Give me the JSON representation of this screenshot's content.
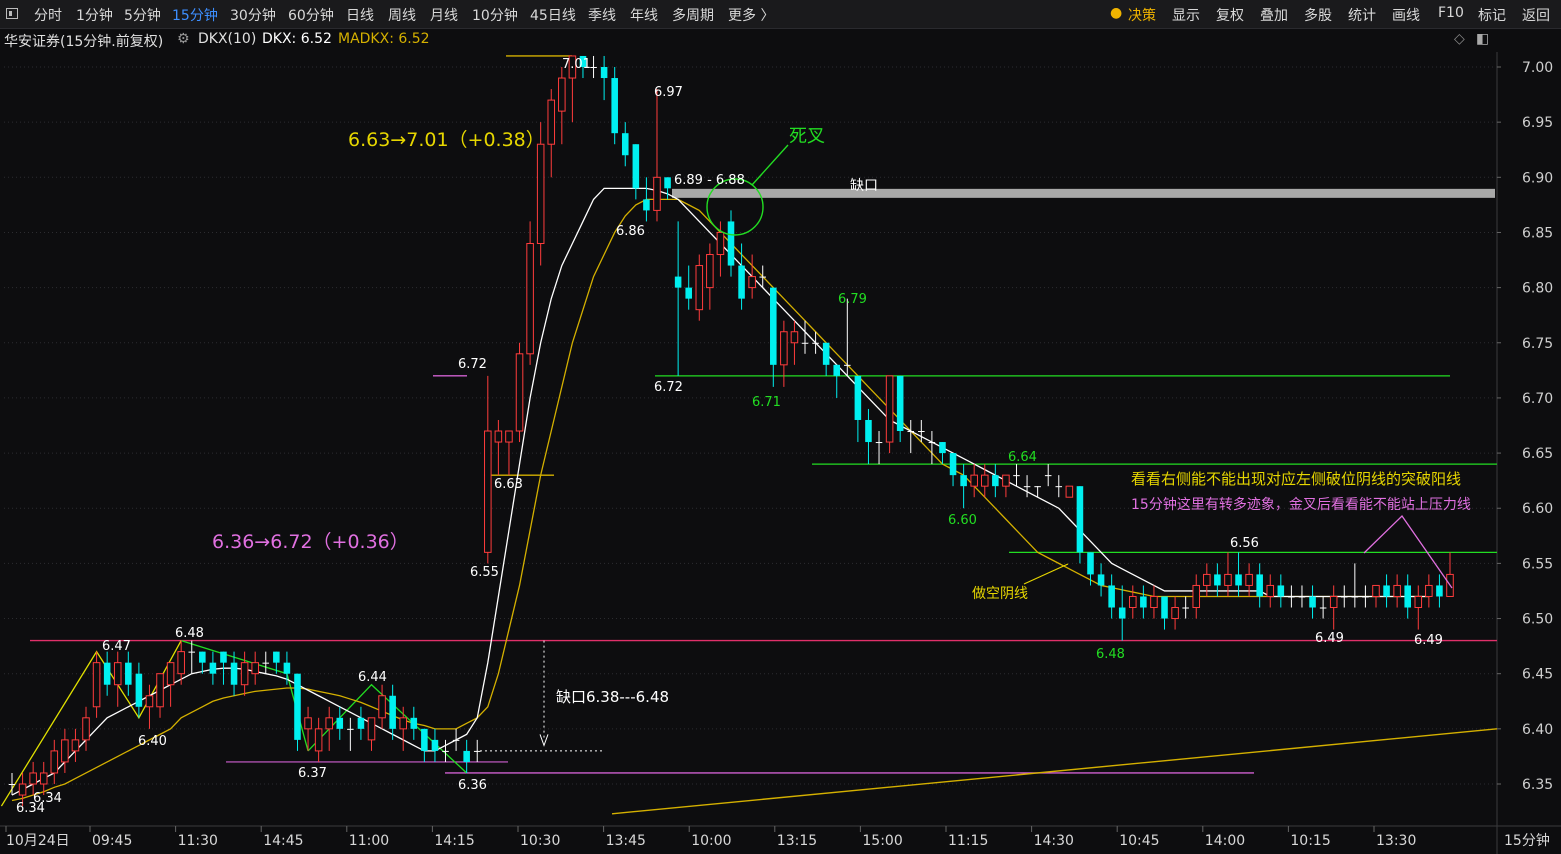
{
  "toolbar": {
    "periods": [
      "分时",
      "1分钟",
      "5分钟",
      "15分钟",
      "30分钟",
      "60分钟",
      "日线",
      "周线",
      "月线",
      "10分钟",
      "45日线",
      "季线",
      "年线",
      "多周期",
      "更多 〉"
    ],
    "active_period": "15分钟",
    "right_items": [
      "决策",
      "显示",
      "复权",
      "叠加",
      "多股",
      "统计",
      "画线",
      "F10",
      "标记",
      "返回"
    ]
  },
  "info": {
    "title": "华安证券(15分钟.前复权)",
    "indicator": "DKX(10)",
    "dkx": "DKX: 6.52",
    "madkx": "MADKX: 6.52"
  },
  "chart_data": {
    "type": "candlestick",
    "title": "华安证券(15分钟.前复权)",
    "period_label": "15分钟",
    "ylim": [
      6.31,
      7.05
    ],
    "y_ticks": [
      6.35,
      6.4,
      6.45,
      6.5,
      6.55,
      6.6,
      6.65,
      6.7,
      6.75,
      6.8,
      6.85,
      6.9,
      6.95,
      7.0
    ],
    "x_tick_labels": [
      "10月24日",
      "09:45",
      "11:30",
      "14:45",
      "11:00",
      "14:15",
      "10:30",
      "13:45",
      "10:00",
      "13:15",
      "15:00",
      "11:15",
      "14:30",
      "10:45",
      "14:00",
      "10:15",
      "13:30"
    ],
    "colors": {
      "up": "#ff3c3c",
      "down": "#00f0f0",
      "doji": "#ffffff",
      "dkx": "#ffffff",
      "madkx": "#d4b000",
      "bg": "#0d0d0f",
      "grid": "#2c2c30"
    },
    "candles": [
      {
        "o": 6.35,
        "h": 6.36,
        "l": 6.34,
        "c": 6.35
      },
      {
        "o": 6.34,
        "h": 6.36,
        "l": 6.33,
        "c": 6.35
      },
      {
        "o": 6.35,
        "h": 6.37,
        "l": 6.34,
        "c": 6.36
      },
      {
        "o": 6.35,
        "h": 6.37,
        "l": 6.34,
        "c": 6.36
      },
      {
        "o": 6.36,
        "h": 6.39,
        "l": 6.35,
        "c": 6.38
      },
      {
        "o": 6.37,
        "h": 6.4,
        "l": 6.36,
        "c": 6.39
      },
      {
        "o": 6.38,
        "h": 6.4,
        "l": 6.37,
        "c": 6.39
      },
      {
        "o": 6.39,
        "h": 6.42,
        "l": 6.38,
        "c": 6.41
      },
      {
        "o": 6.42,
        "h": 6.47,
        "l": 6.41,
        "c": 6.46
      },
      {
        "o": 6.46,
        "h": 6.47,
        "l": 6.43,
        "c": 6.44
      },
      {
        "o": 6.44,
        "h": 6.47,
        "l": 6.42,
        "c": 6.46
      },
      {
        "o": 6.46,
        "h": 6.47,
        "l": 6.43,
        "c": 6.44
      },
      {
        "o": 6.45,
        "h": 6.46,
        "l": 6.41,
        "c": 6.42
      },
      {
        "o": 6.42,
        "h": 6.44,
        "l": 6.4,
        "c": 6.43
      },
      {
        "o": 6.42,
        "h": 6.45,
        "l": 6.41,
        "c": 6.45
      },
      {
        "o": 6.44,
        "h": 6.46,
        "l": 6.42,
        "c": 6.46
      },
      {
        "o": 6.45,
        "h": 6.48,
        "l": 6.44,
        "c": 6.47
      },
      {
        "o": 6.47,
        "h": 6.48,
        "l": 6.45,
        "c": 6.47
      },
      {
        "o": 6.47,
        "h": 6.47,
        "l": 6.45,
        "c": 6.46
      },
      {
        "o": 6.46,
        "h": 6.47,
        "l": 6.44,
        "c": 6.45
      },
      {
        "o": 6.47,
        "h": 6.47,
        "l": 6.44,
        "c": 6.46
      },
      {
        "o": 6.46,
        "h": 6.47,
        "l": 6.43,
        "c": 6.44
      },
      {
        "o": 6.44,
        "h": 6.47,
        "l": 6.43,
        "c": 6.46
      },
      {
        "o": 6.45,
        "h": 6.47,
        "l": 6.44,
        "c": 6.46
      },
      {
        "o": 6.46,
        "h": 6.47,
        "l": 6.45,
        "c": 6.46
      },
      {
        "o": 6.47,
        "h": 6.47,
        "l": 6.45,
        "c": 6.46
      },
      {
        "o": 6.46,
        "h": 6.47,
        "l": 6.44,
        "c": 6.45
      },
      {
        "o": 6.45,
        "h": 6.45,
        "l": 6.38,
        "c": 6.39
      },
      {
        "o": 6.4,
        "h": 6.42,
        "l": 6.38,
        "c": 6.41
      },
      {
        "o": 6.38,
        "h": 6.41,
        "l": 6.37,
        "c": 6.4
      },
      {
        "o": 6.4,
        "h": 6.42,
        "l": 6.38,
        "c": 6.41
      },
      {
        "o": 6.41,
        "h": 6.42,
        "l": 6.39,
        "c": 6.4
      },
      {
        "o": 6.4,
        "h": 6.41,
        "l": 6.38,
        "c": 6.4
      },
      {
        "o": 6.41,
        "h": 6.42,
        "l": 6.39,
        "c": 6.4
      },
      {
        "o": 6.39,
        "h": 6.41,
        "l": 6.38,
        "c": 6.41
      },
      {
        "o": 6.41,
        "h": 6.44,
        "l": 6.4,
        "c": 6.43
      },
      {
        "o": 6.43,
        "h": 6.44,
        "l": 6.39,
        "c": 6.4
      },
      {
        "o": 6.4,
        "h": 6.42,
        "l": 6.38,
        "c": 6.41
      },
      {
        "o": 6.41,
        "h": 6.42,
        "l": 6.39,
        "c": 6.4
      },
      {
        "o": 6.4,
        "h": 6.4,
        "l": 6.37,
        "c": 6.38
      },
      {
        "o": 6.39,
        "h": 6.4,
        "l": 6.37,
        "c": 6.38
      },
      {
        "o": 6.38,
        "h": 6.39,
        "l": 6.37,
        "c": 6.38
      },
      {
        "o": 6.39,
        "h": 6.4,
        "l": 6.38,
        "c": 6.39
      },
      {
        "o": 6.38,
        "h": 6.39,
        "l": 6.36,
        "c": 6.37
      },
      {
        "o": 6.38,
        "h": 6.39,
        "l": 6.37,
        "c": 6.38
      },
      {
        "o": 6.56,
        "h": 6.72,
        "l": 6.55,
        "c": 6.67
      },
      {
        "o": 6.66,
        "h": 6.68,
        "l": 6.63,
        "c": 6.67
      },
      {
        "o": 6.66,
        "h": 6.67,
        "l": 6.63,
        "c": 6.67
      },
      {
        "o": 6.67,
        "h": 6.75,
        "l": 6.66,
        "c": 6.74
      },
      {
        "o": 6.74,
        "h": 6.86,
        "l": 6.73,
        "c": 6.84
      },
      {
        "o": 6.84,
        "h": 6.95,
        "l": 6.82,
        "c": 6.93
      },
      {
        "o": 6.93,
        "h": 6.98,
        "l": 6.9,
        "c": 6.97
      },
      {
        "o": 6.96,
        "h": 7.0,
        "l": 6.93,
        "c": 6.99
      },
      {
        "o": 6.99,
        "h": 7.01,
        "l": 6.95,
        "c": 7.01
      },
      {
        "o": 7.01,
        "h": 7.01,
        "l": 6.99,
        "c": 7.0
      },
      {
        "o": 7.0,
        "h": 7.01,
        "l": 6.99,
        "c": 7.0
      },
      {
        "o": 7.0,
        "h": 7.01,
        "l": 6.97,
        "c": 6.99
      },
      {
        "o": 6.99,
        "h": 7.0,
        "l": 6.93,
        "c": 6.94
      },
      {
        "o": 6.94,
        "h": 6.95,
        "l": 6.91,
        "c": 6.92
      },
      {
        "o": 6.93,
        "h": 6.93,
        "l": 6.88,
        "c": 6.89
      },
      {
        "o": 6.88,
        "h": 6.9,
        "l": 6.86,
        "c": 6.87
      },
      {
        "o": 6.87,
        "h": 6.98,
        "l": 6.86,
        "c": 6.9
      },
      {
        "o": 6.9,
        "h": 6.9,
        "l": 6.88,
        "c": 6.89
      },
      {
        "o": 6.81,
        "h": 6.86,
        "l": 6.72,
        "c": 6.8
      },
      {
        "o": 6.8,
        "h": 6.82,
        "l": 6.78,
        "c": 6.79
      },
      {
        "o": 6.78,
        "h": 6.83,
        "l": 6.77,
        "c": 6.82
      },
      {
        "o": 6.8,
        "h": 6.84,
        "l": 6.78,
        "c": 6.83
      },
      {
        "o": 6.83,
        "h": 6.86,
        "l": 6.81,
        "c": 6.85
      },
      {
        "o": 6.86,
        "h": 6.87,
        "l": 6.81,
        "c": 6.82
      },
      {
        "o": 6.82,
        "h": 6.84,
        "l": 6.78,
        "c": 6.79
      },
      {
        "o": 6.8,
        "h": 6.83,
        "l": 6.79,
        "c": 6.81
      },
      {
        "o": 6.81,
        "h": 6.82,
        "l": 6.8,
        "c": 6.81
      },
      {
        "o": 6.8,
        "h": 6.8,
        "l": 6.71,
        "c": 6.73
      },
      {
        "o": 6.73,
        "h": 6.77,
        "l": 6.71,
        "c": 6.76
      },
      {
        "o": 6.75,
        "h": 6.77,
        "l": 6.73,
        "c": 6.76
      },
      {
        "o": 6.75,
        "h": 6.77,
        "l": 6.74,
        "c": 6.75
      },
      {
        "o": 6.75,
        "h": 6.76,
        "l": 6.74,
        "c": 6.75
      },
      {
        "o": 6.75,
        "h": 6.75,
        "l": 6.72,
        "c": 6.73
      },
      {
        "o": 6.73,
        "h": 6.73,
        "l": 6.7,
        "c": 6.72
      },
      {
        "o": 6.73,
        "h": 6.79,
        "l": 6.72,
        "c": 6.73
      },
      {
        "o": 6.72,
        "h": 6.72,
        "l": 6.66,
        "c": 6.68
      },
      {
        "o": 6.68,
        "h": 6.69,
        "l": 6.64,
        "c": 6.66
      },
      {
        "o": 6.66,
        "h": 6.67,
        "l": 6.64,
        "c": 6.66
      },
      {
        "o": 6.66,
        "h": 6.72,
        "l": 6.65,
        "c": 6.72
      },
      {
        "o": 6.72,
        "h": 6.72,
        "l": 6.66,
        "c": 6.67
      },
      {
        "o": 6.67,
        "h": 6.68,
        "l": 6.65,
        "c": 6.67
      },
      {
        "o": 6.67,
        "h": 6.68,
        "l": 6.66,
        "c": 6.67
      },
      {
        "o": 6.66,
        "h": 6.67,
        "l": 6.64,
        "c": 6.66
      },
      {
        "o": 6.66,
        "h": 6.66,
        "l": 6.64,
        "c": 6.65
      },
      {
        "o": 6.65,
        "h": 6.65,
        "l": 6.62,
        "c": 6.63
      },
      {
        "o": 6.63,
        "h": 6.64,
        "l": 6.6,
        "c": 6.62
      },
      {
        "o": 6.62,
        "h": 6.64,
        "l": 6.61,
        "c": 6.63
      },
      {
        "o": 6.62,
        "h": 6.64,
        "l": 6.61,
        "c": 6.63
      },
      {
        "o": 6.63,
        "h": 6.64,
        "l": 6.61,
        "c": 6.62
      },
      {
        "o": 6.62,
        "h": 6.63,
        "l": 6.61,
        "c": 6.63
      },
      {
        "o": 6.63,
        "h": 6.64,
        "l": 6.62,
        "c": 6.63
      },
      {
        "o": 6.62,
        "h": 6.63,
        "l": 6.61,
        "c": 6.62
      },
      {
        "o": 6.62,
        "h": 6.62,
        "l": 6.61,
        "c": 6.62
      },
      {
        "o": 6.63,
        "h": 6.64,
        "l": 6.62,
        "c": 6.63
      },
      {
        "o": 6.62,
        "h": 6.63,
        "l": 6.61,
        "c": 6.62
      },
      {
        "o": 6.61,
        "h": 6.62,
        "l": 6.61,
        "c": 6.62
      },
      {
        "o": 6.62,
        "h": 6.62,
        "l": 6.55,
        "c": 6.56
      },
      {
        "o": 6.56,
        "h": 6.56,
        "l": 6.53,
        "c": 6.54
      },
      {
        "o": 6.54,
        "h": 6.55,
        "l": 6.52,
        "c": 6.53
      },
      {
        "o": 6.53,
        "h": 6.54,
        "l": 6.5,
        "c": 6.51
      },
      {
        "o": 6.51,
        "h": 6.53,
        "l": 6.48,
        "c": 6.5
      },
      {
        "o": 6.51,
        "h": 6.53,
        "l": 6.5,
        "c": 6.52
      },
      {
        "o": 6.52,
        "h": 6.53,
        "l": 6.5,
        "c": 6.51
      },
      {
        "o": 6.51,
        "h": 6.53,
        "l": 6.5,
        "c": 6.52
      },
      {
        "o": 6.52,
        "h": 6.52,
        "l": 6.49,
        "c": 6.5
      },
      {
        "o": 6.5,
        "h": 6.52,
        "l": 6.49,
        "c": 6.51
      },
      {
        "o": 6.51,
        "h": 6.52,
        "l": 6.5,
        "c": 6.51
      },
      {
        "o": 6.51,
        "h": 6.54,
        "l": 6.5,
        "c": 6.53
      },
      {
        "o": 6.53,
        "h": 6.55,
        "l": 6.52,
        "c": 6.54
      },
      {
        "o": 6.54,
        "h": 6.55,
        "l": 6.52,
        "c": 6.53
      },
      {
        "o": 6.53,
        "h": 6.56,
        "l": 6.52,
        "c": 6.54
      },
      {
        "o": 6.54,
        "h": 6.56,
        "l": 6.52,
        "c": 6.53
      },
      {
        "o": 6.53,
        "h": 6.55,
        "l": 6.52,
        "c": 6.54
      },
      {
        "o": 6.54,
        "h": 6.55,
        "l": 6.51,
        "c": 6.52
      },
      {
        "o": 6.52,
        "h": 6.54,
        "l": 6.51,
        "c": 6.53
      },
      {
        "o": 6.53,
        "h": 6.54,
        "l": 6.51,
        "c": 6.52
      },
      {
        "o": 6.52,
        "h": 6.53,
        "l": 6.51,
        "c": 6.52
      },
      {
        "o": 6.52,
        "h": 6.53,
        "l": 6.51,
        "c": 6.52
      },
      {
        "o": 6.52,
        "h": 6.53,
        "l": 6.5,
        "c": 6.51
      },
      {
        "o": 6.51,
        "h": 6.52,
        "l": 6.5,
        "c": 6.51
      },
      {
        "o": 6.51,
        "h": 6.53,
        "l": 6.49,
        "c": 6.52
      },
      {
        "o": 6.52,
        "h": 6.53,
        "l": 6.51,
        "c": 6.52
      },
      {
        "o": 6.52,
        "h": 6.55,
        "l": 6.51,
        "c": 6.52
      },
      {
        "o": 6.52,
        "h": 6.53,
        "l": 6.51,
        "c": 6.52
      },
      {
        "o": 6.52,
        "h": 6.53,
        "l": 6.51,
        "c": 6.53
      },
      {
        "o": 6.53,
        "h": 6.54,
        "l": 6.51,
        "c": 6.52
      },
      {
        "o": 6.52,
        "h": 6.54,
        "l": 6.51,
        "c": 6.53
      },
      {
        "o": 6.53,
        "h": 6.54,
        "l": 6.5,
        "c": 6.51
      },
      {
        "o": 6.51,
        "h": 6.53,
        "l": 6.49,
        "c": 6.52
      },
      {
        "o": 6.52,
        "h": 6.54,
        "l": 6.51,
        "c": 6.53
      },
      {
        "o": 6.53,
        "h": 6.54,
        "l": 6.51,
        "c": 6.52
      },
      {
        "o": 6.52,
        "h": 6.56,
        "l": 6.52,
        "c": 6.54
      }
    ],
    "dkx": [
      6.34,
      6.345,
      6.35,
      6.355,
      6.36,
      6.37,
      6.38,
      6.39,
      6.4,
      6.41,
      6.415,
      6.42,
      6.425,
      6.43,
      6.435,
      6.44,
      6.445,
      6.45,
      6.452,
      6.454,
      6.455,
      6.455,
      6.454,
      6.452,
      6.45,
      6.448,
      6.445,
      6.44,
      6.435,
      6.43,
      6.425,
      6.42,
      6.415,
      6.41,
      6.405,
      6.4,
      6.395,
      6.39,
      6.385,
      6.38,
      6.38,
      6.385,
      6.39,
      6.395,
      6.41,
      6.46,
      6.52,
      6.58,
      6.64,
      6.7,
      6.75,
      6.79,
      6.82,
      6.84,
      6.86,
      6.88,
      6.89,
      6.89,
      6.89,
      6.89,
      6.89,
      6.888,
      6.885,
      6.88,
      6.87,
      6.86,
      6.85,
      6.84,
      6.83,
      6.82,
      6.81,
      6.8,
      6.79,
      6.78,
      6.77,
      6.76,
      6.75,
      6.74,
      6.73,
      6.72,
      6.71,
      6.7,
      6.69,
      6.68,
      6.675,
      6.67,
      6.665,
      6.66,
      6.655,
      6.65,
      6.645,
      6.64,
      6.635,
      6.63,
      6.625,
      6.62,
      6.615,
      6.61,
      6.605,
      6.6,
      6.59,
      6.58,
      6.57,
      6.56,
      6.55,
      6.545,
      6.54,
      6.535,
      6.53,
      6.525,
      6.525,
      6.525,
      6.525,
      6.525,
      6.525,
      6.525,
      6.525,
      6.525,
      6.525,
      6.52,
      6.52,
      6.52,
      6.52,
      6.52,
      6.52,
      6.52,
      6.52,
      6.52,
      6.52,
      6.52,
      6.52,
      6.52,
      6.52,
      6.52,
      6.52
    ],
    "madkx": [
      6.335,
      6.337,
      6.34,
      6.343,
      6.347,
      6.35,
      6.355,
      6.36,
      6.365,
      6.37,
      6.375,
      6.38,
      6.385,
      6.39,
      6.395,
      6.4,
      6.41,
      6.415,
      6.42,
      6.425,
      6.428,
      6.43,
      6.432,
      6.434,
      6.435,
      6.436,
      6.437,
      6.437,
      6.436,
      6.434,
      6.432,
      6.43,
      6.427,
      6.424,
      6.42,
      6.416,
      6.412,
      6.408,
      6.405,
      6.403,
      6.4,
      6.4,
      6.4,
      6.405,
      6.41,
      6.42,
      6.45,
      6.49,
      6.53,
      6.58,
      6.63,
      6.67,
      6.71,
      6.75,
      6.78,
      6.81,
      6.83,
      6.85,
      6.865,
      6.875,
      6.88,
      6.88,
      6.88,
      6.88,
      6.875,
      6.87,
      6.86,
      6.85,
      6.84,
      6.83,
      6.82,
      6.81,
      6.8,
      6.79,
      6.78,
      6.77,
      6.76,
      6.75,
      6.74,
      6.73,
      6.72,
      6.71,
      6.7,
      6.69,
      6.68,
      6.67,
      6.66,
      6.65,
      6.64,
      6.635,
      6.63,
      6.62,
      6.61,
      6.6,
      6.59,
      6.58,
      6.57,
      6.56,
      6.555,
      6.55,
      6.545,
      6.54,
      6.535,
      6.53,
      6.528,
      6.526,
      6.524,
      6.522,
      6.52,
      6.52,
      6.52,
      6.52,
      6.52,
      6.52,
      6.52,
      6.52,
      6.52,
      6.52,
      6.52,
      6.52,
      6.52,
      6.52,
      6.52,
      6.52,
      6.52,
      6.52,
      6.52,
      6.52,
      6.52,
      6.52,
      6.52,
      6.52,
      6.52,
      6.52,
      6.52
    ],
    "price_labels": [
      "7.01",
      "6.97",
      "6.86",
      "6.89 - 6.88",
      "6.72",
      "6.71",
      "6.79",
      "6.72",
      "6.63",
      "6.55",
      "6.64",
      "6.60",
      "6.48",
      "6.56",
      "6.49",
      "6.49",
      "6.47",
      "6.48",
      "6.40",
      "6.44",
      "6.37",
      "6.36",
      "6.34"
    ],
    "annotations": {
      "rise1": "6.63→7.01（+0.38）",
      "rise2": "6.36→6.72（+0.36）",
      "death_cross": "死叉",
      "gap_top": "缺口",
      "gap_low": "缺口6.38---6.48",
      "short_candle": "做空阴线",
      "note1": "看看右侧能不能出现对应左侧破位阴线的突破阳线",
      "note2": "15分钟这里有转多迹象，金叉后看看能不能站上压力线"
    }
  }
}
